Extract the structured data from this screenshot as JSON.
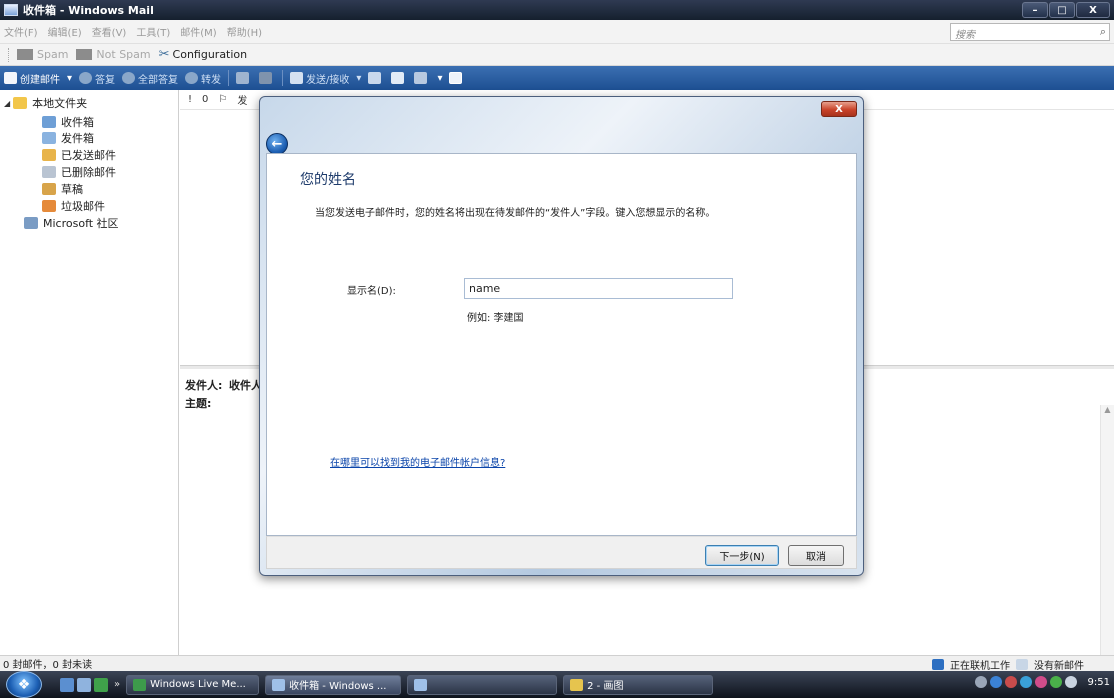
{
  "window": {
    "title": "收件箱 - Windows Mail",
    "min": "–",
    "max": "□",
    "close": "X"
  },
  "menu": {
    "items": [
      "文件(F)",
      "编辑(E)",
      "查看(V)",
      "工具(T)",
      "邮件(M)",
      "帮助(H)"
    ],
    "search_placeholder": "搜索",
    "search_icon": "⌕"
  },
  "spam_toolbar": {
    "spam": "Spam",
    "not_spam": "Not Spam",
    "configuration": "Configuration"
  },
  "toolbar": {
    "create": "创建邮件",
    "reply": "答复",
    "reply_all": "全部答复",
    "forward": "转发",
    "send_receive": "发送/接收",
    "dropdown": "▾"
  },
  "folders": {
    "root": "本地文件夹",
    "inbox": "收件箱",
    "outbox": "发件箱",
    "sent": "已发送邮件",
    "deleted": "已删除邮件",
    "drafts": "草稿",
    "junk": "垃圾邮件",
    "community": "Microsoft 社区"
  },
  "list_header": {
    "c1": "!",
    "c2": "0",
    "c3": "⚐",
    "c4": "发"
  },
  "preview": {
    "from_label": "发件人:",
    "to_label": "收件人",
    "subject_label": "主题:"
  },
  "status": {
    "left": "0 封邮件，0 封未读",
    "online": "正在联机工作",
    "no_new": "没有新邮件"
  },
  "taskbar": {
    "chevron": "»",
    "tasks": [
      "Windows Live Me...",
      "收件箱 - Windows ...",
      "",
      "2 - 画图"
    ],
    "clock": "9:51"
  },
  "dialog": {
    "close": "X",
    "back": "←",
    "heading": "您的姓名",
    "description": "当您发送电子邮件时，您的姓名将出现在待发邮件的“发件人”字段。键入您想显示的名称。",
    "display_name_label": "显示名(D):",
    "display_name_value": "name",
    "example": "例如: 李建国",
    "help_link": "在哪里可以找到我的电子邮件帐户信息?",
    "next_button": "下一步(N)",
    "cancel_button": "取消"
  }
}
